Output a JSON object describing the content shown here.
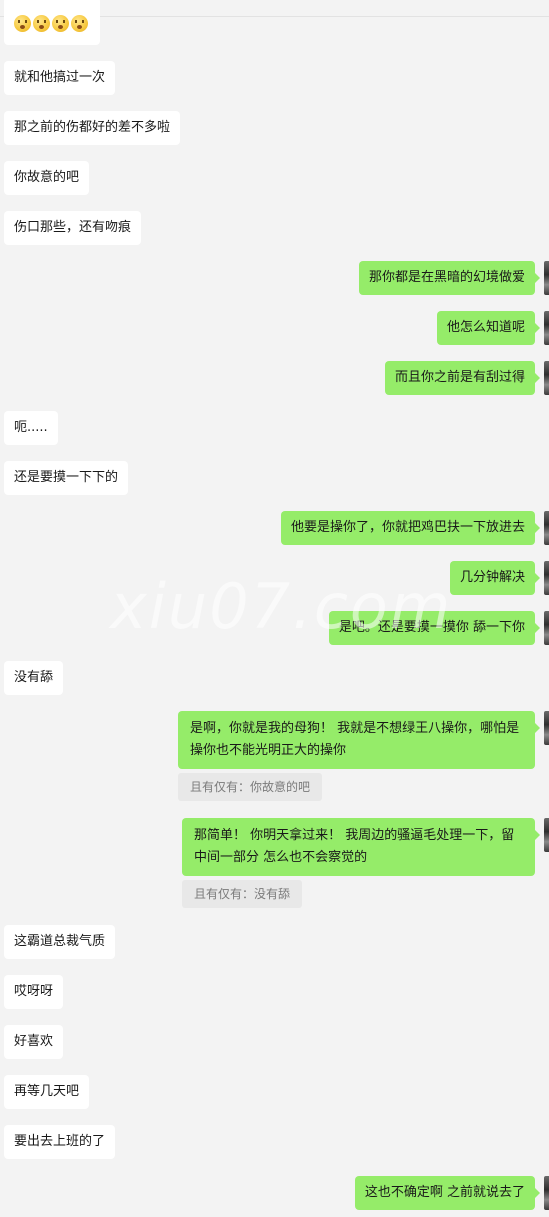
{
  "messages": {
    "m0": "",
    "m1": "就和他搞过一次",
    "m2": "那之前的伤都好的差不多啦",
    "m3": "你故意的吧",
    "m4": "伤口那些，还有吻痕",
    "m5": "那你都是在黑暗的幻境做爱",
    "m6": "他怎么知道呢",
    "m7": "而且你之前是有刮过得",
    "m8": "呃.....",
    "m9": "还是要摸一下下的",
    "m10": "他要是操你了，你就把鸡巴扶一下放进去",
    "m11": "几分钟解决",
    "m12": "是吧。还是要摸一摸你 舔一下你",
    "m13": "没有舔",
    "m14": "是啊，你就是我的母狗！ 我就是不想绿王八操你，哪怕是操你也不能光明正大的操你",
    "m15": "那简单！ 你明天拿过来！ 我周边的骚逼毛处理一下，留中间一部分 怎么也不会察觉的",
    "m16": "这霸道总裁气质",
    "m17": "哎呀呀",
    "m18": "好喜欢",
    "m19": "再等几天吧",
    "m20": "要出去上班的了",
    "m21": "这也不确定啊 之前就说去了"
  },
  "quotes": {
    "q1": "且有仅有：你故意的吧",
    "q2": "且有仅有：没有舔"
  },
  "watermark": "xiu07.com",
  "icons": {
    "emoji": "flushed-face-emoji"
  }
}
